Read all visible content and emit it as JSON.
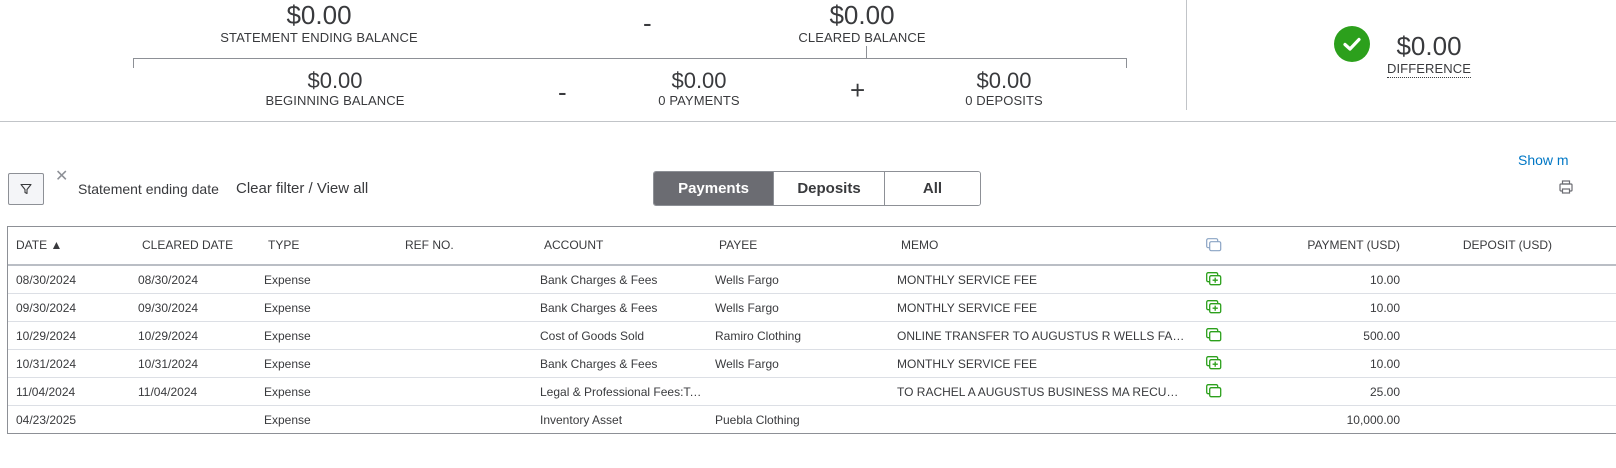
{
  "summary": {
    "statement_ending_balance": {
      "value": "$0.00",
      "label": "STATEMENT ENDING BALANCE"
    },
    "operator_minus_top": "-",
    "cleared_balance": {
      "value": "$0.00",
      "label": "CLEARED BALANCE"
    },
    "beginning_balance": {
      "value": "$0.00",
      "label": "BEGINNING BALANCE"
    },
    "operator_minus_bottom": "-",
    "payments": {
      "value": "$0.00",
      "label": "0 PAYMENTS"
    },
    "operator_plus": "+",
    "deposits": {
      "value": "$0.00",
      "label": "0 DEPOSITS"
    },
    "difference": {
      "value": "$0.00",
      "label": "DIFFERENCE"
    }
  },
  "filter": {
    "close_label": "✕",
    "statement_label": "Statement ending date",
    "clear_label": "Clear filter / View all",
    "show_more_label": "Show m"
  },
  "tabs": [
    "Payments",
    "Deposits",
    "All"
  ],
  "active_tab": "Payments",
  "columns": {
    "date": "DATE ▲",
    "cleared_date": "CLEARED DATE",
    "type": "TYPE",
    "ref_no": "REF NO.",
    "account": "ACCOUNT",
    "payee": "PAYEE",
    "memo": "MEMO",
    "payment": "PAYMENT (USD)",
    "deposit": "DEPOSIT (USD)"
  },
  "rows": [
    {
      "date": "08/30/2024",
      "cleared": "08/30/2024",
      "type": "Expense",
      "ref": "",
      "account": "Bank Charges & Fees",
      "payee": "Wells Fargo",
      "memo": "MONTHLY SERVICE FEE",
      "attach": "add-attachment",
      "payment": "10.00",
      "deposit": ""
    },
    {
      "date": "09/30/2024",
      "cleared": "09/30/2024",
      "type": "Expense",
      "ref": "",
      "account": "Bank Charges & Fees",
      "payee": "Wells Fargo",
      "memo": "MONTHLY SERVICE FEE",
      "attach": "add-attachment",
      "payment": "10.00",
      "deposit": ""
    },
    {
      "date": "10/29/2024",
      "cleared": "10/29/2024",
      "type": "Expense",
      "ref": "",
      "account": "Cost of Goods Sold",
      "payee": "Ramiro Clothing",
      "memo": "ONLINE TRANSFER TO AUGUSTUS R WELLS FARG...",
      "attach": "attachment",
      "payment": "500.00",
      "deposit": ""
    },
    {
      "date": "10/31/2024",
      "cleared": "10/31/2024",
      "type": "Expense",
      "ref": "",
      "account": "Bank Charges & Fees",
      "payee": "Wells Fargo",
      "memo": "MONTHLY SERVICE FEE",
      "attach": "add-attachment",
      "payment": "10.00",
      "deposit": ""
    },
    {
      "date": "11/04/2024",
      "cleared": "11/04/2024",
      "type": "Expense",
      "ref": "",
      "account": "Legal & Professional Fees:Tax...",
      "payee": "",
      "memo": "TO RACHEL A AUGUSTUS BUSINESS MA RECURRIN...",
      "attach": "attachment",
      "payment": "25.00",
      "deposit": ""
    },
    {
      "date": "04/23/2025",
      "cleared": "",
      "type": "Expense",
      "ref": "",
      "account": "Inventory Asset",
      "payee": "Puebla Clothing",
      "memo": "",
      "attach": "",
      "payment": "10,000.00",
      "deposit": ""
    }
  ],
  "colors": {
    "green": "#2ca01c",
    "link": "#0077c5",
    "active_tab": "#6b6c72",
    "icon_green": "#2ca01c",
    "icon_blue": "#8aa4c4"
  }
}
